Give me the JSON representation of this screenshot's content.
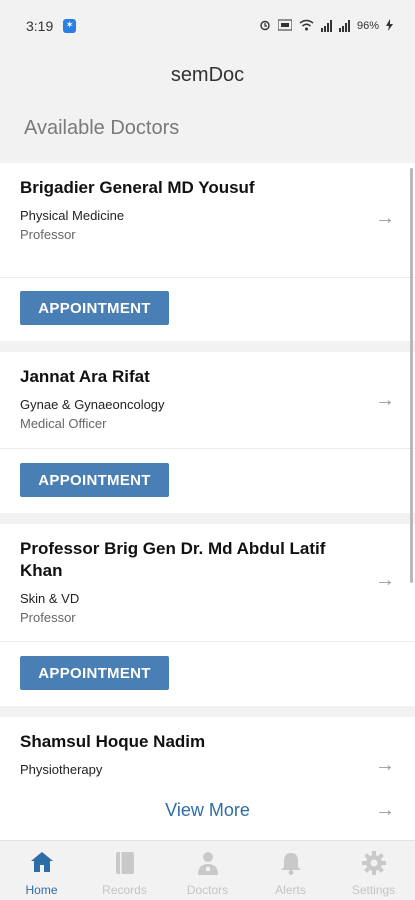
{
  "status_bar": {
    "time": "3:19",
    "notif_badge": "✶",
    "battery": "96%",
    "accent": "#2a7de1"
  },
  "header": {
    "app_title": "semDoc",
    "section_title": "Available Doctors"
  },
  "doctors": [
    {
      "name": "Brigadier General MD Yousuf",
      "department": "Physical Medicine",
      "designation": "Professor",
      "button_label": "APPOINTMENT"
    },
    {
      "name": "Jannat Ara Rifat",
      "department": "Gynae & Gynaeoncology",
      "designation": "Medical Officer",
      "button_label": "APPOINTMENT"
    },
    {
      "name": "Professor Brig Gen Dr. Md Abdul Latif Khan",
      "department": "Skin & VD",
      "designation": "Professor",
      "button_label": "APPOINTMENT"
    },
    {
      "name": "Shamsul Hoque Nadim",
      "department": "Physiotherapy",
      "designation": ""
    }
  ],
  "view_more": "View More",
  "arrow_glyph": "→",
  "bottom_nav": [
    {
      "label": "Home",
      "icon": "home-icon",
      "active": true
    },
    {
      "label": "Records",
      "icon": "book-icon",
      "active": false
    },
    {
      "label": "Doctors",
      "icon": "doctor-icon",
      "active": false
    },
    {
      "label": "Alerts",
      "icon": "bell-icon",
      "active": false
    },
    {
      "label": "Settings",
      "icon": "gear-icon",
      "active": false
    }
  ],
  "colors": {
    "primary": "#4a7fb5",
    "link": "#2e6da8",
    "background": "#f2f2f2"
  }
}
